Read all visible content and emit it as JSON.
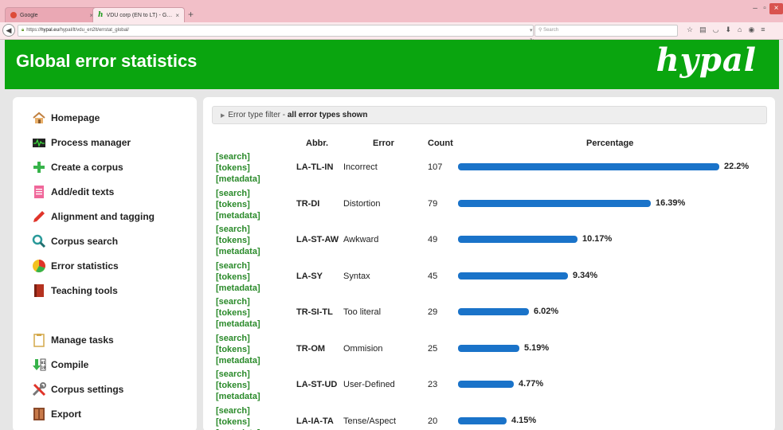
{
  "browser": {
    "tabs": [
      {
        "title": "Google",
        "close": "×"
      },
      {
        "title": "VDU corp (EN to LT) - Glo...",
        "close": "×"
      }
    ],
    "new_tab": "+",
    "url_prefix": "https://",
    "url_domain": "hypal.eu",
    "url_path": "/hypal/lt/vdu_en2lt/errstat_global/",
    "search_placeholder": "Search",
    "window_controls": {
      "minimize": "–",
      "maximize": "▫",
      "close": "×"
    }
  },
  "header": {
    "title": "Global error statistics",
    "logo": "hypal",
    "color": "#0aa50f"
  },
  "sidebar": {
    "items": [
      {
        "label": "Homepage",
        "icon": "home-icon"
      },
      {
        "label": "Process manager",
        "icon": "process-monitor-icon"
      },
      {
        "label": "Create a corpus",
        "icon": "plus-icon"
      },
      {
        "label": "Add/edit texts",
        "icon": "document-icon"
      },
      {
        "label": "Alignment and tagging",
        "icon": "pen-icon"
      },
      {
        "label": "Corpus search",
        "icon": "magnifier-icon"
      },
      {
        "label": "Error statistics",
        "icon": "pie-chart-icon"
      },
      {
        "label": "Teaching tools",
        "icon": "book-icon"
      },
      {
        "label": "Manage tasks",
        "icon": "clipboard-icon"
      },
      {
        "label": "Compile",
        "icon": "compile-icon"
      },
      {
        "label": "Corpus settings",
        "icon": "tools-icon"
      },
      {
        "label": "Export",
        "icon": "export-icon"
      }
    ]
  },
  "filter": {
    "label": "Error type filter - ",
    "state": "all error types shown"
  },
  "table": {
    "headers": {
      "abbr": "Abbr.",
      "error": "Error",
      "count": "Count",
      "percentage": "Percentage"
    },
    "link_labels": {
      "search": "[search]",
      "tokens": "[tokens]",
      "metadata": "[metadata]"
    },
    "bar_color": "#1a73c9",
    "rows": [
      {
        "abbr": "LA-TL-IN",
        "error": "Incorrect",
        "count": "107",
        "percentage": "22.2%"
      },
      {
        "abbr": "TR-DI",
        "error": "Distortion",
        "count": "79",
        "percentage": "16.39%"
      },
      {
        "abbr": "LA-ST-AW",
        "error": "Awkward",
        "count": "49",
        "percentage": "10.17%"
      },
      {
        "abbr": "LA-SY",
        "error": "Syntax",
        "count": "45",
        "percentage": "9.34%"
      },
      {
        "abbr": "TR-SI-TL",
        "error": "Too literal",
        "count": "29",
        "percentage": "6.02%"
      },
      {
        "abbr": "TR-OM",
        "error": "Ommision",
        "count": "25",
        "percentage": "5.19%"
      },
      {
        "abbr": "LA-ST-UD",
        "error": "User-Defined",
        "count": "23",
        "percentage": "4.77%"
      },
      {
        "abbr": "LA-IA-TA",
        "error": "Tense/Aspect",
        "count": "20",
        "percentage": "4.15%"
      }
    ]
  }
}
